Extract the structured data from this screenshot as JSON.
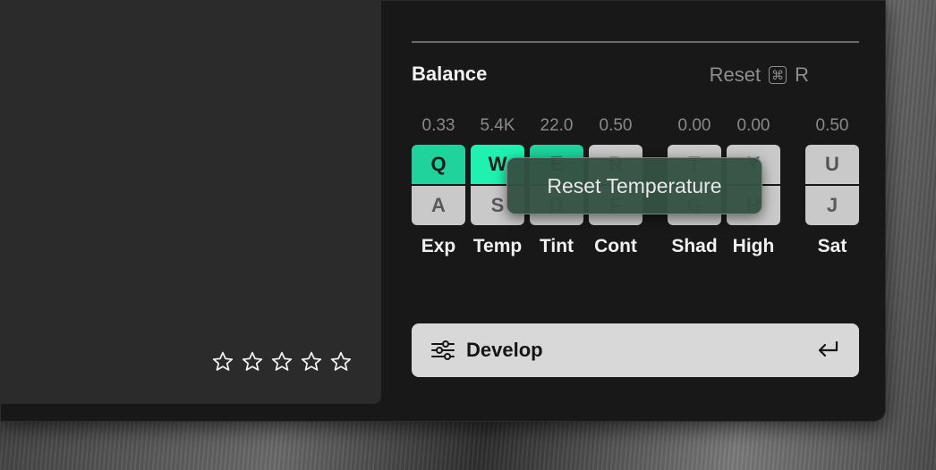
{
  "rating": {
    "stars": 5,
    "filled": 0
  },
  "panel": {
    "title": "Balance",
    "reset_label": "Reset",
    "reset_shortcut_symbol": "⌘",
    "reset_shortcut_key": "R"
  },
  "sliders": [
    {
      "value": "0.33",
      "upper_key": "Q",
      "lower_key": "A",
      "label": "Exp"
    },
    {
      "value": "5.4K",
      "upper_key": "W",
      "lower_key": "S",
      "label": "Temp"
    },
    {
      "value": "22.0",
      "upper_key": "E",
      "lower_key": "D",
      "label": "Tint"
    },
    {
      "value": "0.50",
      "upper_key": "R",
      "lower_key": "F",
      "label": "Cont"
    },
    {
      "value": "0.00",
      "upper_key": "T",
      "lower_key": "G",
      "label": "Shad"
    },
    {
      "value": "0.00",
      "upper_key": "Y",
      "lower_key": "H",
      "label": "High"
    },
    {
      "value": "0.50",
      "upper_key": "U",
      "lower_key": "J",
      "label": "Sat"
    }
  ],
  "tooltip": {
    "text": "Reset Temperature"
  },
  "develop": {
    "label": "Develop",
    "icon": "sliders-icon",
    "shortcut_icon": "return-icon"
  },
  "colors": {
    "accent_strong": "#1ff2b0",
    "accent_mid": "#20d29c",
    "key_bg": "#c9c9c9"
  }
}
